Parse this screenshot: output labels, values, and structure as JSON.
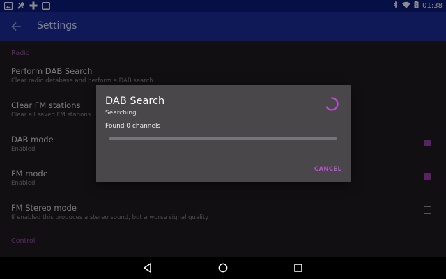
{
  "status_bar": {
    "left_icons": [
      "image-icon",
      "wrench-icon",
      "gamepad-icon",
      "cast-icon"
    ],
    "right_icons": [
      "bluetooth-icon",
      "wifi-icon",
      "battery-icon"
    ],
    "time": "01:38"
  },
  "app_bar": {
    "title": "Settings"
  },
  "settings": {
    "radio_section": "Radio",
    "perform_dab": {
      "title": "Perform DAB Search",
      "summary": "Clear radio database and perform a DAB search"
    },
    "clear_fm": {
      "title": "Clear FM stations",
      "summary": "Clear all saved FM stations"
    },
    "dab_mode": {
      "title": "DAB mode",
      "summary": "Enabled",
      "checked": true
    },
    "fm_mode": {
      "title": "FM mode",
      "summary": "Enabled",
      "checked": true
    },
    "fm_stereo": {
      "title": "FM Stereo mode",
      "summary": "If enabled this produces a stereo sound, but a worse signal quality",
      "checked": false
    },
    "control_section": "Control"
  },
  "dialog": {
    "title": "DAB Search",
    "status": "Searching",
    "found_text": "Found 0 channels",
    "progress_fraction": 0,
    "cancel_label": "CANCEL"
  },
  "colors": {
    "accent": "#a33fbb",
    "app_bar": "#1c2ea0",
    "status_bar": "#0d1d82",
    "dialog_bg": "#4a474b"
  },
  "nav_bar": {
    "buttons": [
      "back-icon",
      "home-icon",
      "recents-icon"
    ]
  }
}
